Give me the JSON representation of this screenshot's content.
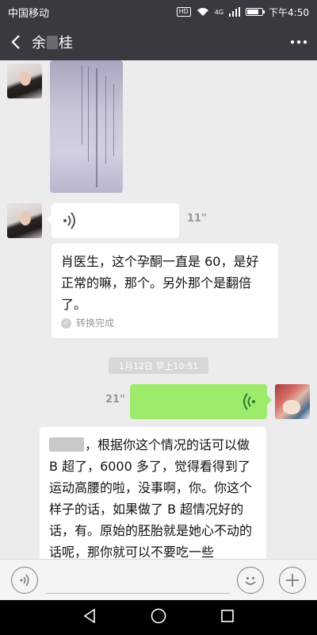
{
  "status_bar": {
    "carrier": "中国移动",
    "hd": "HD",
    "network": "4G",
    "time": "下午4:50",
    "battery_level": 0.8
  },
  "header": {
    "title_prefix": "余",
    "title_suffix": "桂"
  },
  "messages": [
    {
      "type": "image",
      "from": "contact"
    },
    {
      "type": "voice",
      "from": "contact",
      "duration": "11\""
    },
    {
      "type": "transcript",
      "text": "肖医生，这个孕酮一直是 60，是好正常的嘛，那个。另外那个是翻倍了。",
      "status": "转换完成"
    },
    {
      "type": "timestamp",
      "text": "1月12日 早上10:51"
    },
    {
      "type": "voice",
      "from": "me",
      "duration": "21\""
    },
    {
      "type": "transcript",
      "text": "，根据你这个情况的话可以做 B 超了，6000 多了，觉得看得到了运动高腰的啦，没事啊，你。你这个样子的话，如果做了 B 超情况好的话，有。原始的胚胎就是她心不动的话呢，那你就可以不要吃一些"
    }
  ],
  "colors": {
    "header_bg": "#393a3f",
    "chat_bg": "#ececec",
    "outgoing_bubble": "#9eea6a",
    "incoming_bubble": "#ffffff"
  },
  "icons": [
    "back-arrow-icon",
    "more-icon",
    "voice-icon",
    "emoji-icon",
    "plus-icon",
    "nav-back-icon",
    "nav-home-icon",
    "nav-recents-icon"
  ]
}
